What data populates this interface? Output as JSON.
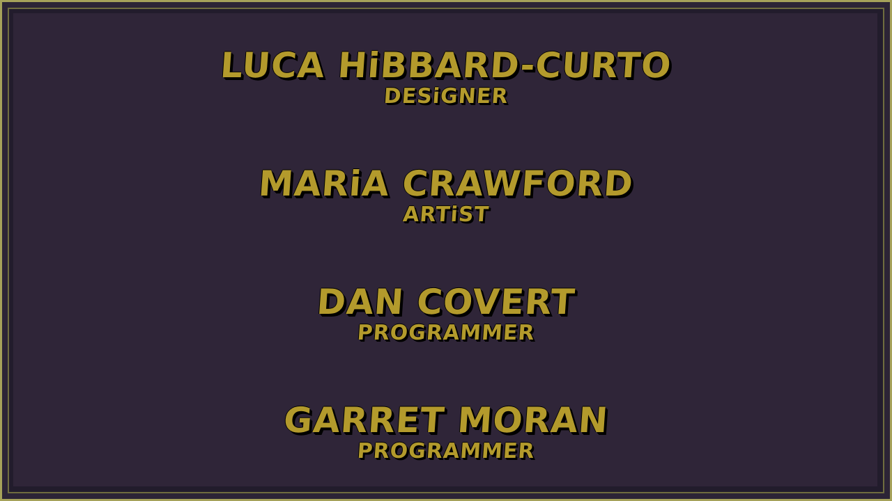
{
  "colors": {
    "text": "#b39a2c",
    "shadow": "#000000",
    "background": "#2f2538",
    "frame": "#a6a25a"
  },
  "credits": [
    {
      "name": "LUCA HiBBARD-CURTO",
      "role": "DESiGNER"
    },
    {
      "name": "MARiA CRAWFORD",
      "role": "ARTiST"
    },
    {
      "name": "DAN COVERT",
      "role": "PROGRAMMER"
    },
    {
      "name": "GARRET MORAN",
      "role": "PROGRAMMER"
    }
  ]
}
